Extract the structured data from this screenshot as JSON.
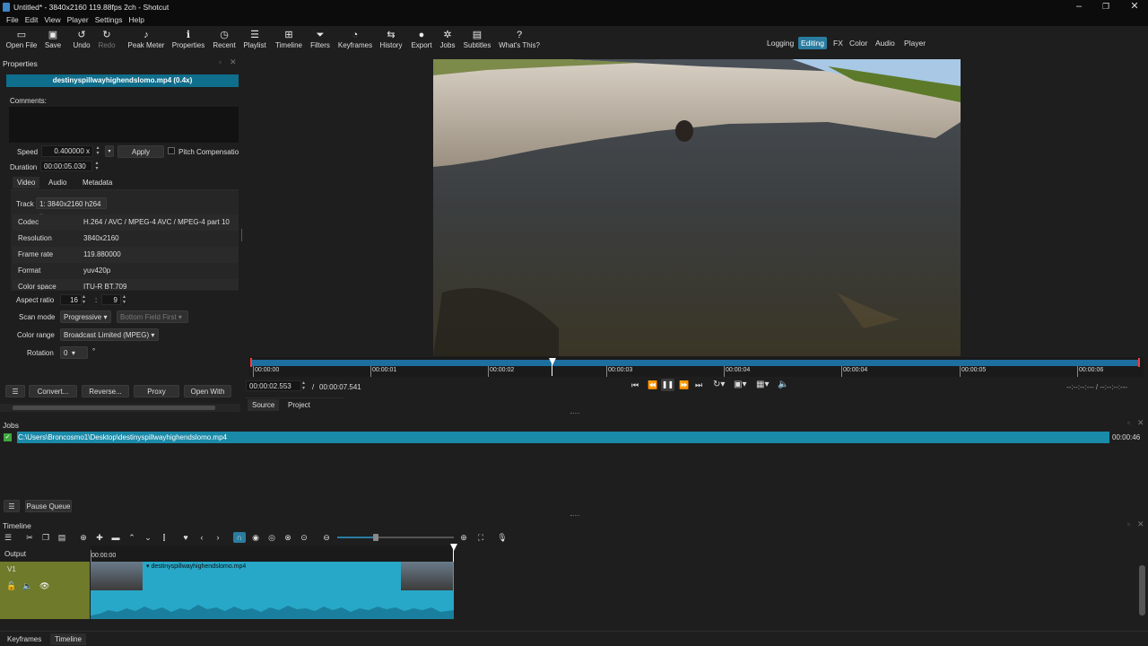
{
  "window": {
    "title": "Untitled* - 3840x2160 119.88fps 2ch - Shotcut"
  },
  "menu": [
    "File",
    "Edit",
    "View",
    "Player",
    "Settings",
    "Help"
  ],
  "toolbar": [
    {
      "label": "Open File",
      "icon": "folder-open-icon"
    },
    {
      "label": "Save",
      "icon": "save-icon"
    },
    {
      "label": "Undo",
      "icon": "undo-icon"
    },
    {
      "label": "Redo",
      "icon": "redo-icon"
    },
    {
      "label": "Peak Meter",
      "icon": "peak-meter-icon"
    },
    {
      "label": "Properties",
      "icon": "properties-icon"
    },
    {
      "label": "Recent",
      "icon": "recent-icon"
    },
    {
      "label": "Playlist",
      "icon": "playlist-icon"
    },
    {
      "label": "Timeline",
      "icon": "timeline-icon"
    },
    {
      "label": "Filters",
      "icon": "filters-icon"
    },
    {
      "label": "Keyframes",
      "icon": "keyframes-icon"
    },
    {
      "label": "History",
      "icon": "history-icon"
    },
    {
      "label": "Export",
      "icon": "export-icon"
    },
    {
      "label": "Jobs",
      "icon": "jobs-icon"
    },
    {
      "label": "Subtitles",
      "icon": "subtitles-icon"
    },
    {
      "label": "What's This?",
      "icon": "whats-this-icon"
    }
  ],
  "layouts": [
    "Logging",
    "Editing",
    "FX",
    "Color",
    "Audio",
    "Player"
  ],
  "properties": {
    "title": "Properties",
    "file_header": "destinyspillwayhighendslomo.mp4 (0.4x)",
    "comments_label": "Comments:",
    "speed_label": "Speed",
    "speed_value": "0.400000 x",
    "apply": "Apply",
    "pitch": "Pitch Compensation",
    "duration_label": "Duration",
    "duration_value": "00:00:05.030",
    "tabs": [
      "Video",
      "Audio",
      "Metadata"
    ],
    "track_label": "Track",
    "track_value": "1: 3840x2160 h264",
    "info": [
      {
        "k": "Codec",
        "v": "H.264 / AVC / MPEG-4 AVC / MPEG-4 part 10"
      },
      {
        "k": "Resolution",
        "v": "3840x2160"
      },
      {
        "k": "Frame rate",
        "v": "119.880000"
      },
      {
        "k": "Format",
        "v": "yuv420p"
      },
      {
        "k": "Color space",
        "v": "ITU-R BT.709"
      }
    ],
    "aspect_label": "Aspect ratio",
    "aspect_w": "16",
    "aspect_sep": ":",
    "aspect_h": "9",
    "scan_label": "Scan mode",
    "scan_value": "Progressive",
    "field_value": "Bottom Field First",
    "range_label": "Color range",
    "range_value": "Broadcast Limited (MPEG)",
    "rotation_label": "Rotation",
    "rotation_value": "0",
    "rotation_unit": "°",
    "buttons": [
      "Convert...",
      "Reverse...",
      "Proxy",
      "Open With"
    ]
  },
  "player": {
    "ticks": [
      "00:00:00",
      "00:00:01",
      "00:00:02",
      "00:00:03",
      "00:00:04",
      "00:00:04",
      "00:00:05",
      "00:00:06"
    ],
    "position": "00:00:02.553",
    "duration": "00:00:07.541",
    "sep": "/",
    "inout": "--:--:--:--- / --:--:--:---",
    "tabs": [
      "Source",
      "Project"
    ]
  },
  "jobs": {
    "title": "Jobs",
    "job_path": "C:\\Users\\Broncosmo1\\Desktop\\destinyspillwayhighendslomo.mp4",
    "job_time": "00:00:46",
    "pause": "Pause Queue"
  },
  "timeline": {
    "title": "Timeline",
    "output": "Output",
    "track": "V1",
    "time0": "00:00:00",
    "clip": "destinyspillwayhighendslomo.mp4"
  },
  "bottom_tabs": [
    "Keyframes",
    "Timeline"
  ]
}
